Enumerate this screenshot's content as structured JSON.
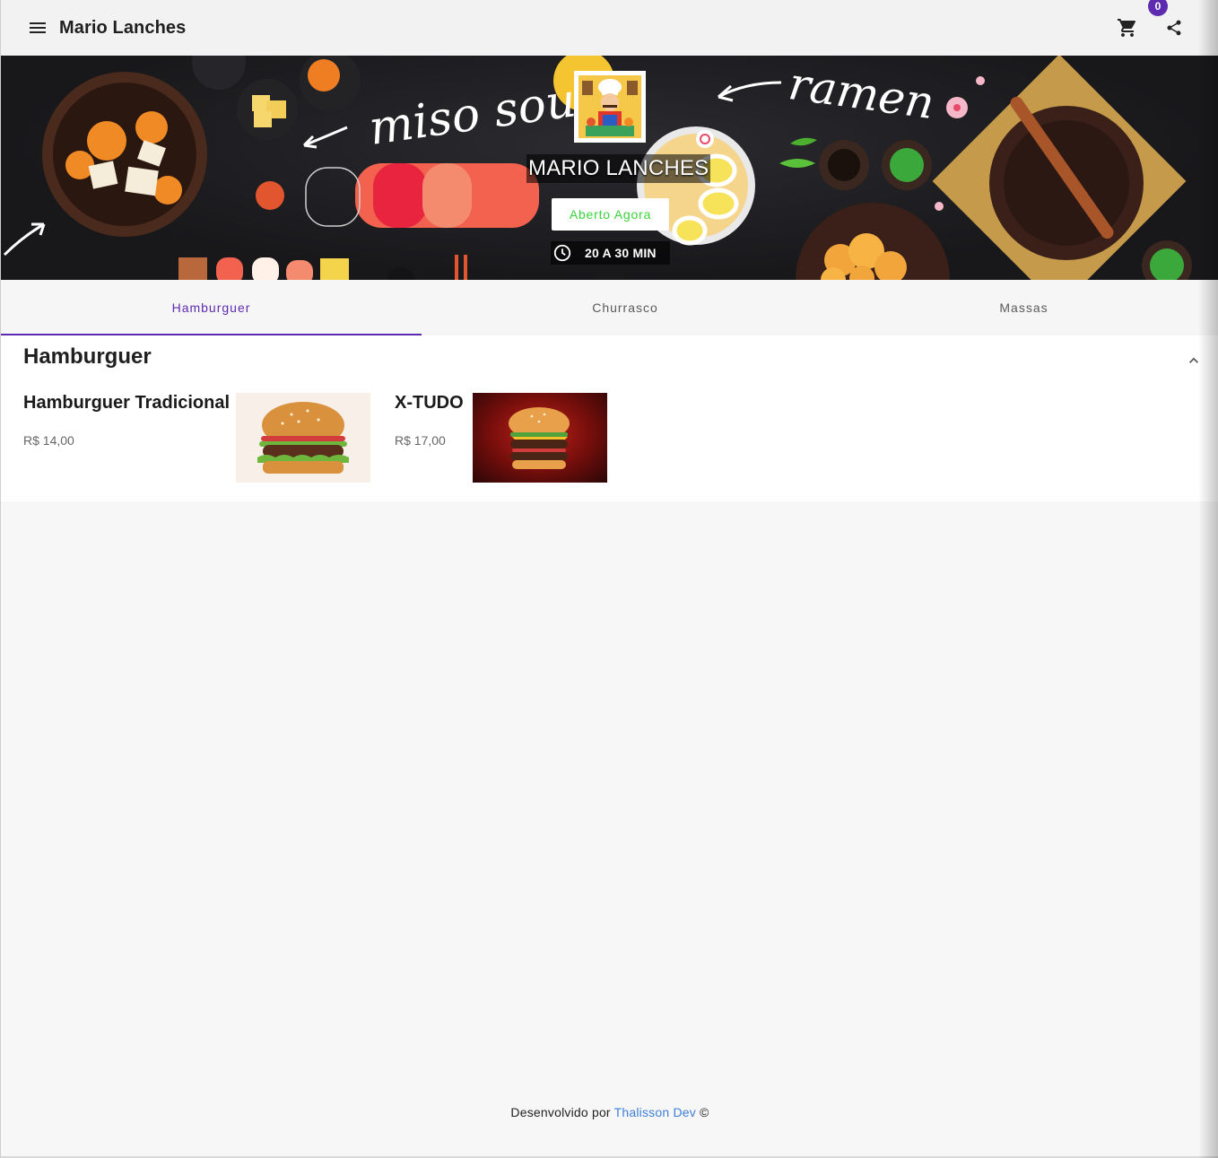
{
  "app_bar": {
    "title": "Mario Lanches",
    "cart_count": "0",
    "icons": {
      "menu": "menu-icon",
      "cart": "cart-icon",
      "share": "share-icon"
    }
  },
  "hero": {
    "store_name": "MARIO LANCHES",
    "status": "Aberto Agora",
    "eta": "20 A 30 MIN",
    "banner_text_left": "miso soup",
    "banner_text_right": "ramen",
    "status_color": "#3ad33a"
  },
  "tabs": [
    {
      "label": "Hamburguer",
      "active": true
    },
    {
      "label": "Churrasco",
      "active": false
    },
    {
      "label": "Massas",
      "active": false
    }
  ],
  "category": {
    "title": "Hamburguer",
    "products": [
      {
        "name": "Hamburguer Tradicional",
        "price": "R$ 14,00"
      },
      {
        "name": "X-TUDO",
        "price": "R$ 17,00"
      }
    ]
  },
  "footer": {
    "prefix": "Desenvolvido por",
    "link": "Thalisson Dev",
    "suffix": "©"
  },
  "colors": {
    "accent": "#5e2bb0",
    "link": "#3d7fd8"
  }
}
